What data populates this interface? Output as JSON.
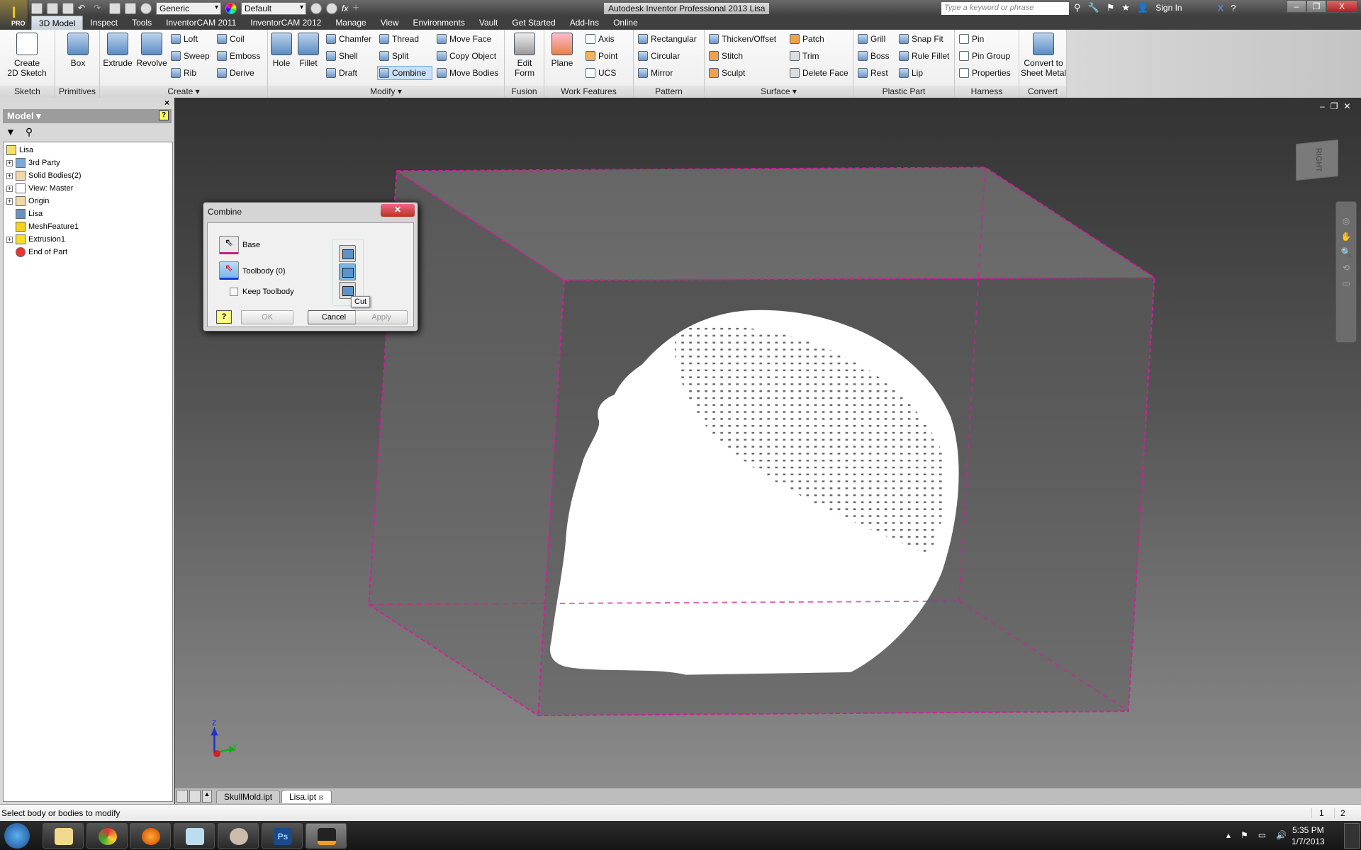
{
  "app": {
    "title": "Autodesk Inventor Professional 2013   Lisa",
    "logo_text": "PRO"
  },
  "qat": {
    "material": "Generic",
    "appearance": "Default"
  },
  "search": {
    "placeholder": "Type a keyword or phrase"
  },
  "infocenter": {
    "sign_in": "Sign In"
  },
  "menu_tabs": [
    "3D Model",
    "Inspect",
    "Tools",
    "InventorCAM 2011",
    "InventorCAM 2012",
    "Manage",
    "View",
    "Environments",
    "Vault",
    "Get Started",
    "Add-Ins",
    "Online"
  ],
  "ribbon": {
    "sketch": {
      "label": "Sketch",
      "create_2d_sketch": "Create\n2D Sketch"
    },
    "primitives": {
      "label": "Primitives",
      "box": "Box"
    },
    "create": {
      "label": "Create ▾",
      "extrude": "Extrude",
      "revolve": "Revolve",
      "loft": "Loft",
      "sweep": "Sweep",
      "rib": "Rib",
      "coil": "Coil",
      "emboss": "Emboss",
      "derive": "Derive"
    },
    "modify": {
      "label": "Modify ▾",
      "hole": "Hole",
      "fillet": "Fillet",
      "chamfer": "Chamfer",
      "shell": "Shell",
      "draft": "Draft",
      "thread": "Thread",
      "split": "Split",
      "combine": "Combine",
      "move_face": "Move Face",
      "copy_object": "Copy Object",
      "move_bodies": "Move Bodies"
    },
    "fusion": {
      "label": "Fusion",
      "edit_form": "Edit\nForm"
    },
    "work_features": {
      "label": "Work Features",
      "plane": "Plane",
      "axis": "Axis",
      "point": "Point",
      "ucs": "UCS"
    },
    "pattern": {
      "label": "Pattern",
      "rectangular": "Rectangular",
      "circular": "Circular",
      "mirror": "Mirror"
    },
    "surface": {
      "label": "Surface ▾",
      "thicken_offset": "Thicken/Offset",
      "stitch": "Stitch",
      "sculpt": "Sculpt",
      "patch": "Patch",
      "trim": "Trim",
      "delete_face": "Delete Face"
    },
    "plastic_part": {
      "label": "Plastic Part",
      "grill": "Grill",
      "boss": "Boss",
      "rest": "Rest",
      "snap_fit": "Snap Fit",
      "rule_fillet": "Rule Fillet",
      "lip": "Lip"
    },
    "harness": {
      "label": "Harness",
      "pin": "Pin",
      "pin_group": "Pin Group",
      "properties": "Properties"
    },
    "convert": {
      "label": "Convert",
      "convert_to_sheet_metal": "Convert to\nSheet Metal"
    }
  },
  "browser": {
    "title": "Model ▾",
    "tree": [
      {
        "label": "Lisa",
        "expandable": false,
        "root": true
      },
      {
        "label": "3rd Party",
        "expandable": true
      },
      {
        "label": "Solid Bodies(2)",
        "expandable": true
      },
      {
        "label": "View: Master",
        "expandable": true
      },
      {
        "label": "Origin",
        "expandable": true
      },
      {
        "label": "Lisa",
        "expandable": false
      },
      {
        "label": "MeshFeature1",
        "expandable": false
      },
      {
        "label": "Extrusion1",
        "expandable": true
      },
      {
        "label": "End of Part",
        "expandable": false
      }
    ]
  },
  "viewcube": {
    "face": "RIGHT"
  },
  "dialog": {
    "title": "Combine",
    "base": "Base",
    "toolbody": "Toolbody (0)",
    "keep_toolbody": "Keep Toolbody",
    "keep_toolbody_checked": false,
    "ok": "OK",
    "cancel": "Cancel",
    "apply": "Apply",
    "tooltip": "Cut",
    "selected_operation": "Cut"
  },
  "triad": {
    "z": "Z",
    "y": "Y"
  },
  "doc_tabs": [
    "SkullMold.ipt",
    "Lisa.ipt"
  ],
  "active_doc": "Lisa.ipt",
  "status": {
    "message": "Select body or bodies to modify",
    "count1": "1",
    "count2": "2"
  },
  "taskbar": {
    "time": "5:35 PM",
    "date": "1/7/2013"
  },
  "colors": {
    "edge_highlight": "#d0209a",
    "ribbon_select": "#c9e0f7"
  }
}
